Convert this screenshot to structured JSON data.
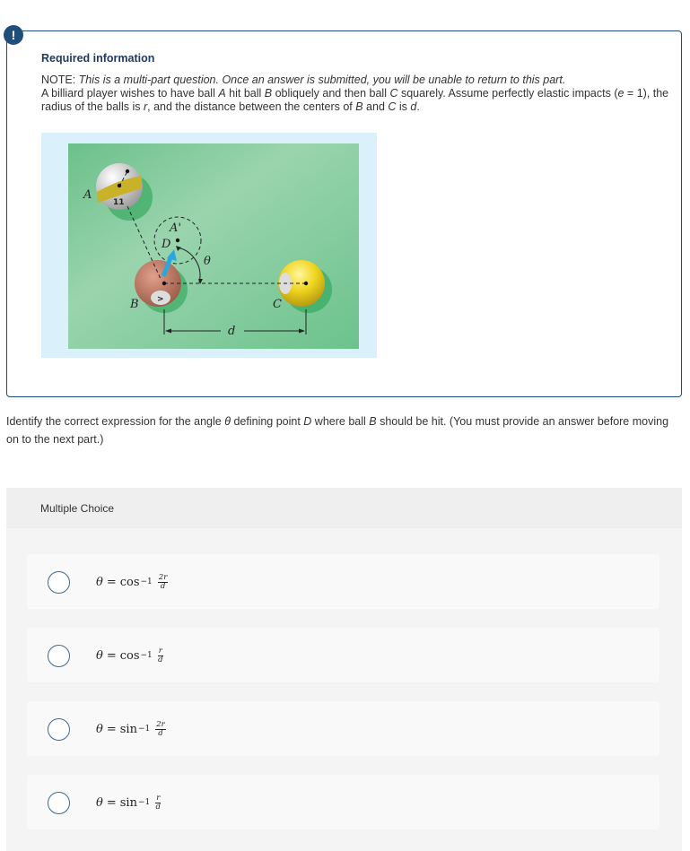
{
  "info": {
    "badge": "!",
    "title": "Required information",
    "note_label": "NOTE: ",
    "note_text": "This is a multi-part question. Once an answer is submitted, you will be unable to return to this part.",
    "problem_p1": "A billiard player wishes to have ball ",
    "ball_a": "A",
    "problem_p2": " hit ball ",
    "ball_b": "B",
    "problem_p3": " obliquely and then ball ",
    "ball_c": "C",
    "problem_p4": " squarely. Assume perfectly elastic impacts (",
    "e_sym": "e",
    "problem_p5": " = 1), the radius of the balls is ",
    "r_sym": "r",
    "problem_p6": ", and the distance between the centers of ",
    "problem_p7": " and ",
    "problem_p8": " is ",
    "d_sym": "d",
    "problem_p9": "."
  },
  "figure": {
    "labels": {
      "a": "A",
      "a_prime": "A'",
      "b": "B",
      "c": "C",
      "d_point": "D",
      "theta": "θ",
      "dist": "d",
      "ball_a_number": "11"
    },
    "colors": {
      "table": "#8ccea3",
      "frame": "#daf0fb",
      "arrow": "#29a8e0",
      "ball_b": "#b8705a",
      "ball_c": "#f0d520",
      "ball_a_stripe": "#c9b12a"
    }
  },
  "prompt": {
    "p1": "Identify the correct expression for the angle ",
    "theta": "θ",
    "p2": " defining point ",
    "d_point": "D",
    "p3": " where ball ",
    "ball": "B",
    "p4": " should be hit. (You must provide an answer before moving on to the next part.)"
  },
  "multiple_choice": {
    "label": "Multiple Choice",
    "options": [
      {
        "lhs": "θ",
        "eq": "=",
        "func": "cos",
        "exp": "−1",
        "num": "2r",
        "den": "d",
        "selected": false
      },
      {
        "lhs": "θ",
        "eq": "=",
        "func": "cos",
        "exp": "−1",
        "num": "r",
        "den": "d",
        "selected": false
      },
      {
        "lhs": "θ",
        "eq": "=",
        "func": "sin",
        "exp": "−1",
        "num": "2r",
        "den": "d",
        "selected": false
      },
      {
        "lhs": "θ",
        "eq": "=",
        "func": "sin",
        "exp": "−1",
        "num": "r",
        "den": "d",
        "selected": false
      }
    ]
  }
}
